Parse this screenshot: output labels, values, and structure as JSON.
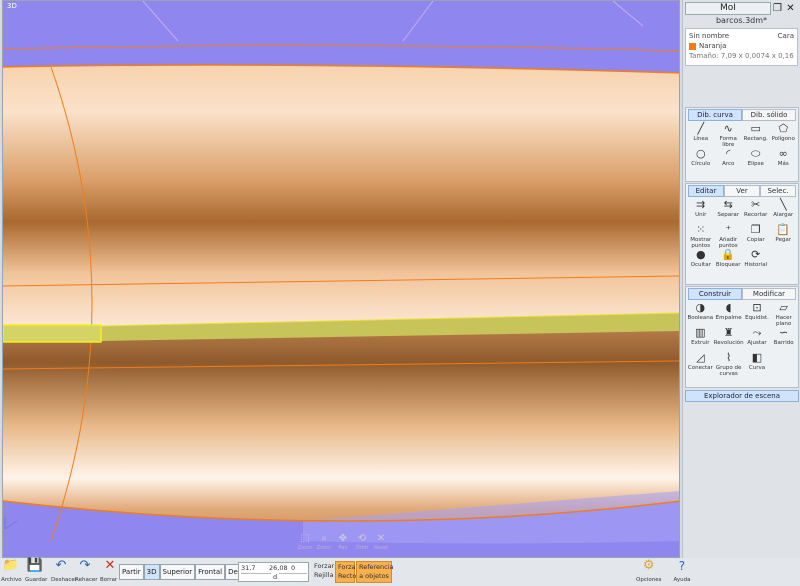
{
  "viewport": {
    "label": "3D"
  },
  "nav_tools": [
    {
      "icon": "zoom-window-icon",
      "glyph": "⬚",
      "label": "Zoom"
    },
    {
      "icon": "zoom-icon",
      "glyph": "⌕",
      "label": "Zoom"
    },
    {
      "icon": "pan-icon",
      "glyph": "✥",
      "label": "Pan"
    },
    {
      "icon": "orbit-icon",
      "glyph": "⟲",
      "label": "Orbit"
    },
    {
      "icon": "reset-icon",
      "glyph": "✕",
      "label": "Reset"
    }
  ],
  "header": {
    "title": "MoI",
    "restore": "❐",
    "close": "✕",
    "filename": "barcos.3dm*"
  },
  "properties": {
    "name": "Sin nombre",
    "type": "Cara",
    "style": "Naranja",
    "size_label": "Tamaño:",
    "size": "7,09 x 0,0074 x 0,16",
    "style_color": "#f07d1a"
  },
  "draw_section": {
    "tabs": [
      "Dib. curva",
      "Dib. sólido"
    ],
    "tools": [
      {
        "label": "Línea",
        "icon": "line-icon",
        "glyph": "╱"
      },
      {
        "label": "Forma libre",
        "icon": "freeform-icon",
        "glyph": "∿"
      },
      {
        "label": "Rectang.",
        "icon": "rectangle-icon",
        "glyph": "▭"
      },
      {
        "label": "Polígono",
        "icon": "polygon-icon",
        "glyph": "⬠"
      },
      {
        "label": "Círculo",
        "icon": "circle-icon",
        "glyph": "○"
      },
      {
        "label": "Arco",
        "icon": "arc-icon",
        "glyph": "◜"
      },
      {
        "label": "Elipse",
        "icon": "ellipse-icon",
        "glyph": "⬭"
      },
      {
        "label": "Más",
        "icon": "more-icon",
        "glyph": "∞"
      }
    ]
  },
  "edit_section": {
    "tabs": [
      "Editar",
      "Ver",
      "Selec."
    ],
    "tools": [
      {
        "label": "Unir",
        "icon": "join-icon",
        "glyph": "⇉"
      },
      {
        "label": "Separar",
        "icon": "separate-icon",
        "glyph": "⇆"
      },
      {
        "label": "Recortar",
        "icon": "trim-icon",
        "glyph": "✂"
      },
      {
        "label": "Alargar",
        "icon": "extend-icon",
        "glyph": "╲"
      },
      {
        "label": "Mostrar puntos",
        "icon": "show-points-icon",
        "glyph": "⁙"
      },
      {
        "label": "Añadir puntos",
        "icon": "add-points-icon",
        "glyph": "⁺"
      },
      {
        "label": "Copiar",
        "icon": "copy-icon",
        "glyph": "❐"
      },
      {
        "label": "Pegar",
        "icon": "paste-icon",
        "glyph": "📋"
      },
      {
        "label": "Ocultar",
        "icon": "hide-icon",
        "glyph": "●"
      },
      {
        "label": "Bloquear",
        "icon": "lock-icon",
        "glyph": "🔒"
      },
      {
        "label": "Historial",
        "icon": "history-icon",
        "glyph": "⟳"
      }
    ]
  },
  "construct_section": {
    "tabs": [
      "Construir",
      "Modificar"
    ],
    "tools": [
      {
        "label": "Booleana",
        "icon": "boolean-icon",
        "glyph": "◑"
      },
      {
        "label": "Empalme",
        "icon": "fillet-icon",
        "glyph": "◖"
      },
      {
        "label": "Equidist.",
        "icon": "offset-icon",
        "glyph": "⊡"
      },
      {
        "label": "Hacer plano",
        "icon": "planar-icon",
        "glyph": "▱"
      },
      {
        "label": "Extruir",
        "icon": "extrude-icon",
        "glyph": "▥"
      },
      {
        "label": "Revolución",
        "icon": "revolve-icon",
        "glyph": "♜"
      },
      {
        "label": "Ajustar",
        "icon": "sweep-icon",
        "glyph": "⤳"
      },
      {
        "label": "Barrido",
        "icon": "barrido-icon",
        "glyph": "∽"
      },
      {
        "label": "Conectar",
        "icon": "connect-icon",
        "glyph": "◿"
      },
      {
        "label": "Grupo de curvas",
        "icon": "curve-network-icon",
        "glyph": "⌇"
      },
      {
        "label": "Curva",
        "icon": "curve-icon",
        "glyph": "◧"
      }
    ]
  },
  "explorer_label": "Explorador de escena",
  "bottom": {
    "file_buttons": [
      {
        "label": "Archivo",
        "icon": "folder-icon",
        "glyph": "📁"
      },
      {
        "label": "Guardar",
        "icon": "save-icon",
        "glyph": "💾"
      },
      {
        "label": "Deshacer",
        "icon": "undo-icon",
        "glyph": "↶"
      },
      {
        "label": "Rehacer",
        "icon": "redo-icon",
        "glyph": "↷"
      },
      {
        "label": "Borrar",
        "icon": "delete-icon",
        "glyph": "✕"
      }
    ],
    "views": [
      "Partir",
      "3D",
      "Superior",
      "Frontal",
      "Derecha"
    ],
    "active_view": "3D",
    "coords": {
      "x": "31,7",
      "y": "26,08",
      "z": "0",
      "d": "d"
    },
    "snap": {
      "grid": "Forzar Rejilla",
      "straight": "Forzar Recto",
      "object": "Referencia a objetos"
    },
    "options_label": "Opciones",
    "help_label": "Ayuda"
  }
}
